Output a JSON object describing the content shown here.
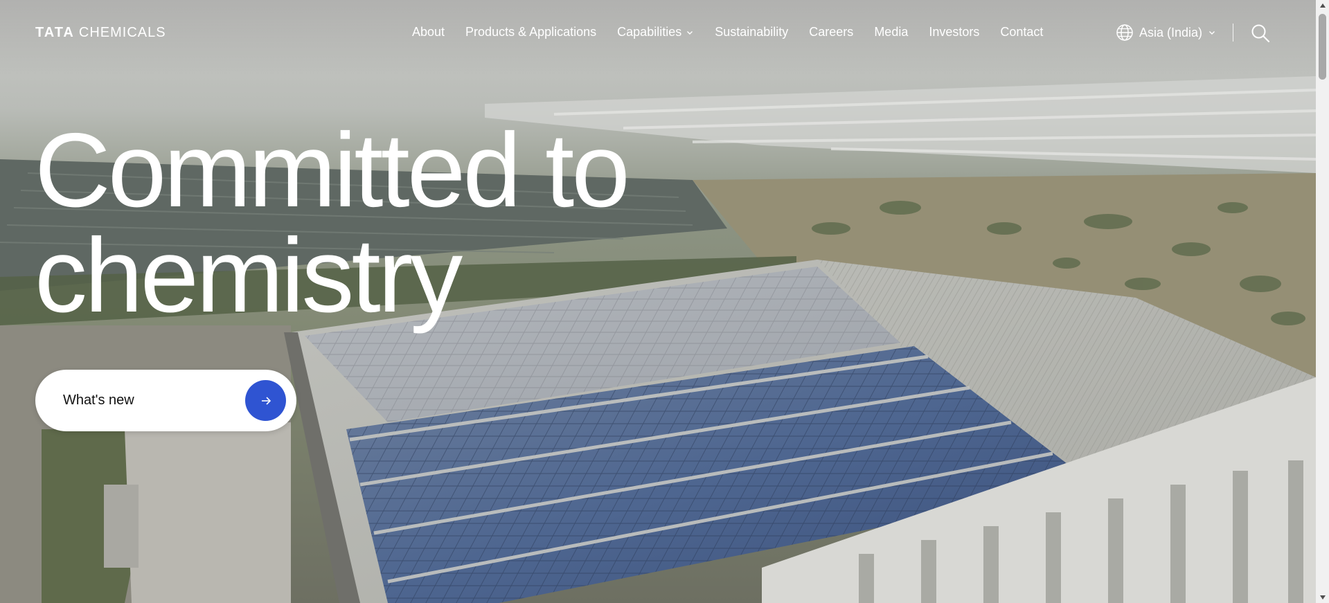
{
  "brand": {
    "logo_text_bold": "TATA",
    "logo_text": "CHEMICALS"
  },
  "nav": {
    "items": [
      {
        "label": "About"
      },
      {
        "label": "Products & Applications"
      },
      {
        "label": "Capabilities"
      },
      {
        "label": "Sustainability"
      },
      {
        "label": "Careers"
      },
      {
        "label": "Media"
      },
      {
        "label": "Investors"
      },
      {
        "label": "Contact"
      }
    ],
    "region_label": "Asia (India)"
  },
  "hero": {
    "headline_line1": "Committed to",
    "headline_line2": "chemistry",
    "cta_label": "What's new",
    "background_description_icon": "solar-panel-factory-rooftop-image"
  },
  "colors": {
    "accent": "#2f54d2",
    "text_on_hero": "#ffffff",
    "cta_bg": "#ffffff"
  }
}
